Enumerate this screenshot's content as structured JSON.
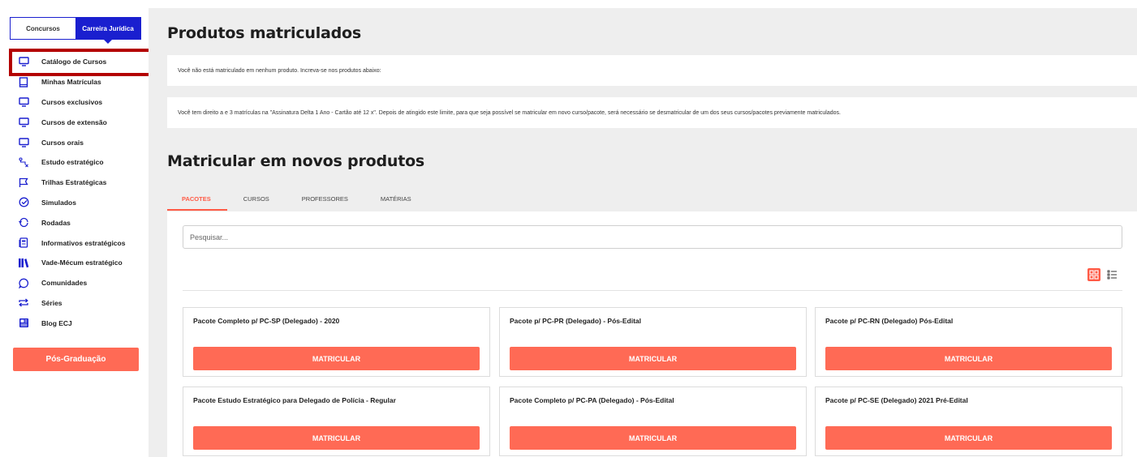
{
  "sidebar": {
    "toggle": {
      "left": "Concursos",
      "right": "Carreira Jurídica"
    },
    "items": [
      {
        "label": "Catálogo de Cursos",
        "icon": "monitor-icon"
      },
      {
        "label": "Minhas Matrículas",
        "icon": "book-icon"
      },
      {
        "label": "Cursos exclusivos",
        "icon": "monitor-icon"
      },
      {
        "label": "Cursos de extensão",
        "icon": "monitor-icon"
      },
      {
        "label": "Cursos orais",
        "icon": "monitor-icon"
      },
      {
        "label": "Estudo estratégico",
        "icon": "route-icon"
      },
      {
        "label": "Trilhas Estratégicas",
        "icon": "flag-icon"
      },
      {
        "label": "Simulados",
        "icon": "check-circle-icon"
      },
      {
        "label": "Rodadas",
        "icon": "refresh-icon"
      },
      {
        "label": "Informativos estratégicos",
        "icon": "document-icon"
      },
      {
        "label": "Vade-Mécum estratégico",
        "icon": "library-icon"
      },
      {
        "label": "Comunidades",
        "icon": "chat-icon"
      },
      {
        "label": "Séries",
        "icon": "repeat-icon"
      },
      {
        "label": "Blog ECJ",
        "icon": "newspaper-icon"
      }
    ],
    "pos_button": "Pós-Graduação"
  },
  "main": {
    "title_enrolled": "Produtos matriculados",
    "info_not_enrolled": "Você não está matriculado em nenhum produto. Increva-se nos produtos abaixo:",
    "info_rights": "Você tem direito a e 3 matrículas na \"Assinatura Delta 1 Ano - Cartão até 12 x\". Depois de atingido este limite, para que seja possível se matricular em novo curso/pacote, será necessário se desmatricular de um dos seus cursos/pacotes previamente matriculados.",
    "title_new": "Matricular em novos produtos",
    "tabs": [
      {
        "label": "PACOTES"
      },
      {
        "label": "CURSOS"
      },
      {
        "label": "PROFESSORES"
      },
      {
        "label": "MATÉRIAS"
      }
    ],
    "search_placeholder": "Pesquisar...",
    "enroll_label": "MATRICULAR",
    "cards": [
      {
        "title": "Pacote Completo p/ PC-SP (Delegado) - 2020"
      },
      {
        "title": "Pacote p/ PC-PR (Delegado) - Pós-Edital"
      },
      {
        "title": "Pacote p/ PC-RN (Delegado) Pós-Edital"
      },
      {
        "title": "Pacote Estudo Estratégico para Delegado de Polícia - Regular"
      },
      {
        "title": "Pacote Completo p/ PC-PA (Delegado) - Pós-Edital"
      },
      {
        "title": "Pacote p/ PC-SE (Delegado) 2021 Pré-Edital"
      }
    ]
  },
  "colors": {
    "accent_blue": "#1a1fcf",
    "accent_coral": "#ff6a55",
    "highlight_red": "#b30000"
  }
}
